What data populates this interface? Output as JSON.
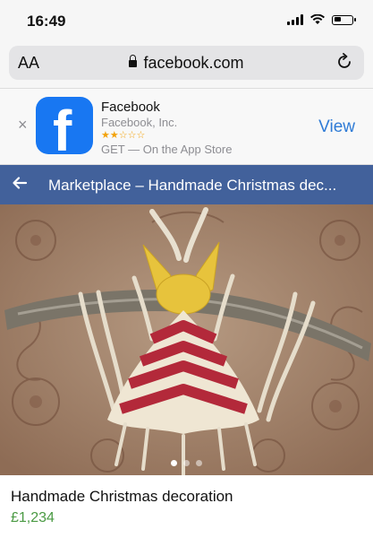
{
  "status_bar": {
    "time": "16:49"
  },
  "browser": {
    "text_size_label": "AA",
    "domain": "facebook.com"
  },
  "app_banner": {
    "close_glyph": "×",
    "app_name": "Facebook",
    "developer": "Facebook, Inc.",
    "rating_stars": "★★☆☆☆",
    "store_text": "GET — On the App Store",
    "view_label": "View",
    "icon_letter": "f"
  },
  "header": {
    "title": "Marketplace – Handmade Christmas dec..."
  },
  "listing": {
    "title": "Handmade Christmas decoration",
    "price": "£1,234",
    "image_dots": {
      "count": 3,
      "active_index": 0
    }
  },
  "colors": {
    "fb_header": "#42619b",
    "fb_blue": "#1877f2",
    "link_blue": "#2f7bd6",
    "price_green": "#4a9a43"
  }
}
